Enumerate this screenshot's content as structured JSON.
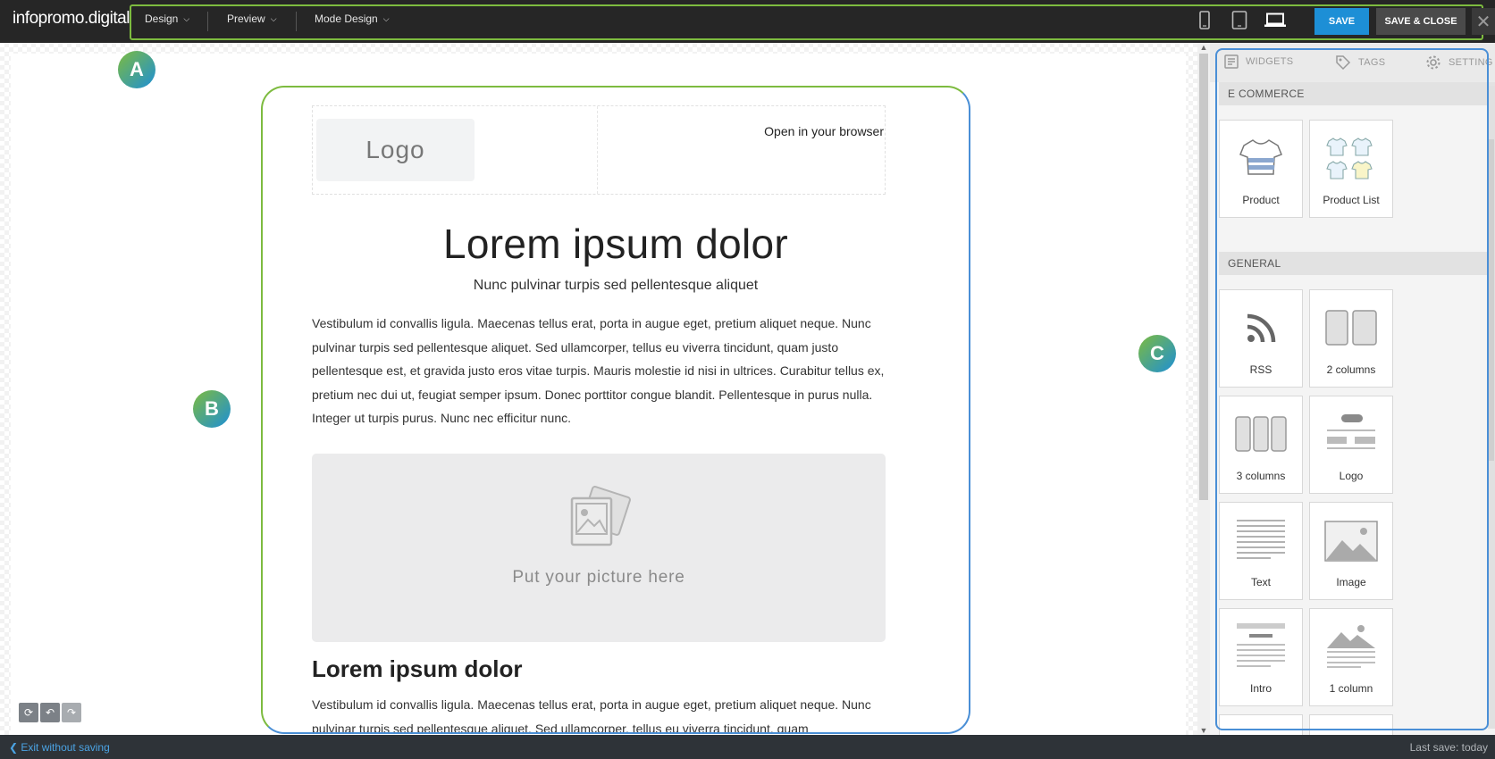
{
  "brand": "infopromo.digital",
  "menu": [
    {
      "label": "Design"
    },
    {
      "label": "Preview"
    },
    {
      "label": "Mode Design"
    }
  ],
  "toolbar": {
    "save_label": "SAVE",
    "save_close_label": "SAVE & CLOSE",
    "close_symbol": "✕",
    "devices": [
      "mobile-icon",
      "tablet-icon",
      "desktop-icon"
    ]
  },
  "markers": {
    "a": "A",
    "b": "B",
    "c": "C"
  },
  "email": {
    "logo_placeholder": "Logo",
    "open_in_browser": "Open in your browser",
    "hero_title": "Lorem ipsum dolor",
    "hero_subtitle": "Nunc pulvinar turpis sed pellentesque aliquet",
    "paragraph1": "Vestibulum id convallis ligula. Maecenas tellus erat, porta in augue eget, pretium aliquet neque. Nunc pulvinar turpis sed pellentesque aliquet. Sed ullamcorper, tellus eu viverra tincidunt, quam justo pellentesque est, et gravida justo eros vitae turpis. Mauris molestie id nisi in ultrices. Curabitur tellus ex, pretium nec dui ut, feugiat semper ipsum. Donec porttitor congue blandit. Pellentesque in purus nulla. Integer ut turpis purus. Nunc nec efficitur nunc.",
    "picture_placeholder": "Put your picture here",
    "section_title": "Lorem ipsum dolor",
    "paragraph2": "Vestibulum id convallis ligula. Maecenas tellus erat, porta in augue eget, pretium aliquet neque. Nunc pulvinar turpis sed pellentesque aliquet. Sed ullamcorper, tellus eu viverra tincidunt, quam"
  },
  "panel": {
    "tabs": [
      {
        "label": "WIDGETS",
        "icon": "widgets-icon"
      },
      {
        "label": "TAGS",
        "icon": "tag-icon"
      },
      {
        "label": "SETTING",
        "icon": "gear-icon"
      }
    ],
    "sections": [
      {
        "title": "E COMMERCE",
        "widgets": [
          {
            "label": "Product",
            "icon": "tshirt-icon"
          },
          {
            "label": "Product List",
            "icon": "product-list-icon"
          }
        ]
      },
      {
        "title": "GENERAL",
        "widgets": [
          {
            "label": "RSS",
            "icon": "rss-icon"
          },
          {
            "label": "2 columns",
            "icon": "two-columns-icon"
          },
          {
            "label": "3 columns",
            "icon": "three-columns-icon"
          },
          {
            "label": "Logo",
            "icon": "logo-block-icon"
          },
          {
            "label": "Text",
            "icon": "text-block-icon"
          },
          {
            "label": "Image",
            "icon": "image-block-icon"
          },
          {
            "label": "Intro",
            "icon": "intro-block-icon"
          },
          {
            "label": "1 column",
            "icon": "one-column-icon"
          }
        ]
      }
    ]
  },
  "history": {
    "icons": [
      "history-icon",
      "undo-icon",
      "redo-icon"
    ]
  },
  "status": {
    "exit_label": "Exit without saving",
    "last_save": "Last save: today"
  },
  "colors": {
    "topbar": "#262626",
    "accent_blue": "#1d8fd6",
    "accent_green": "#7dbb3f",
    "statusbar": "#2e3338"
  }
}
